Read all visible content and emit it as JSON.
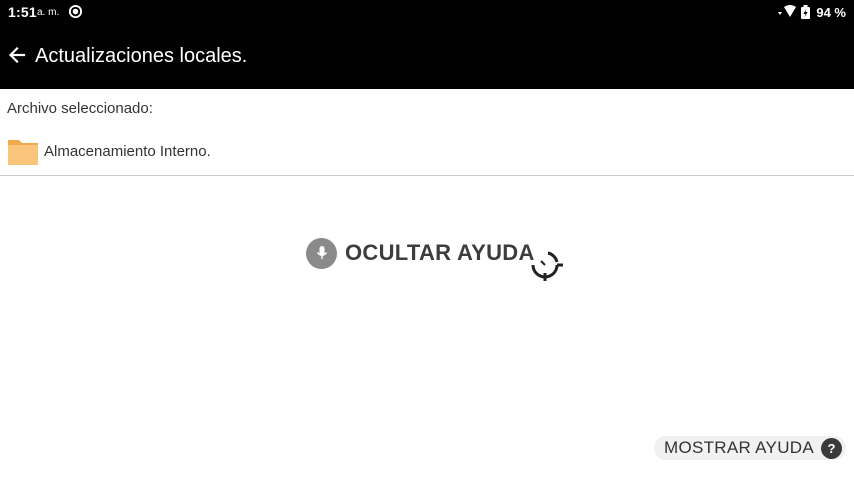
{
  "status_bar": {
    "time": "1:51",
    "ampm": "a. m.",
    "battery": "94 %"
  },
  "app_bar": {
    "title": "Actualizaciones locales."
  },
  "content": {
    "selected_label": "Archivo seleccionado:",
    "storage_label": "Almacenamiento Interno."
  },
  "help": {
    "hide_label": "OCULTAR AYUDA",
    "show_label": "MOSTRAR AYUDA",
    "help_glyph": "?"
  },
  "colors": {
    "bar_background": "#000000",
    "folder": "#f5b55c",
    "mic_background": "#8a8a8a"
  }
}
